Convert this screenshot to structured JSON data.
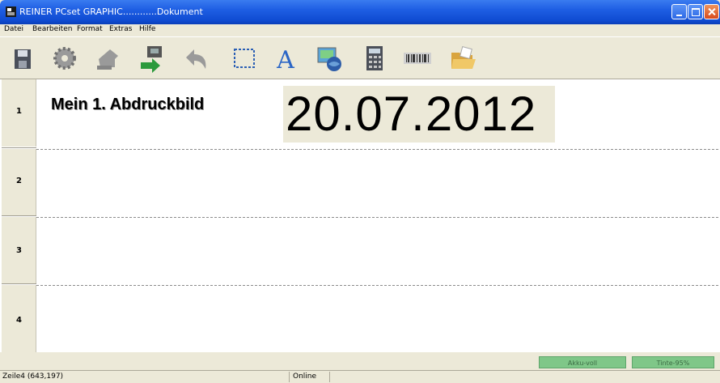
{
  "window": {
    "title": "REINER PCset GRAPHIC............Dokument"
  },
  "menu": [
    {
      "label": "Datei"
    },
    {
      "label": "Bearbeiten"
    },
    {
      "label": "Format"
    },
    {
      "label": "Extras"
    },
    {
      "label": "Hilfe"
    }
  ],
  "toolbar": [
    {
      "icon": "save-icon"
    },
    {
      "icon": "gear-icon"
    },
    {
      "icon": "stamp-icon"
    },
    {
      "icon": "print-transfer-icon"
    },
    {
      "icon": "undo-icon"
    },
    {
      "icon": "select-rectangle-icon"
    },
    {
      "icon": "text-icon"
    },
    {
      "icon": "image-globe-icon"
    },
    {
      "icon": "calculator-icon"
    },
    {
      "icon": "barcode-icon"
    },
    {
      "icon": "open-folder-icon"
    }
  ],
  "rows": [
    {
      "number": "1"
    },
    {
      "number": "2"
    },
    {
      "number": "3"
    },
    {
      "number": "4"
    }
  ],
  "content": {
    "text_label": "Mein 1. Abdruckbild",
    "date": "20.07.2012"
  },
  "status": {
    "akku": "Akku-voll",
    "tinte": "Tinte-95%",
    "position": "Zeile4 (643,197)",
    "connection": "Online"
  },
  "colors": {
    "titlebar": "#0f4bd1",
    "status_chip": "#7fc788",
    "canvas": "#ffffff"
  }
}
